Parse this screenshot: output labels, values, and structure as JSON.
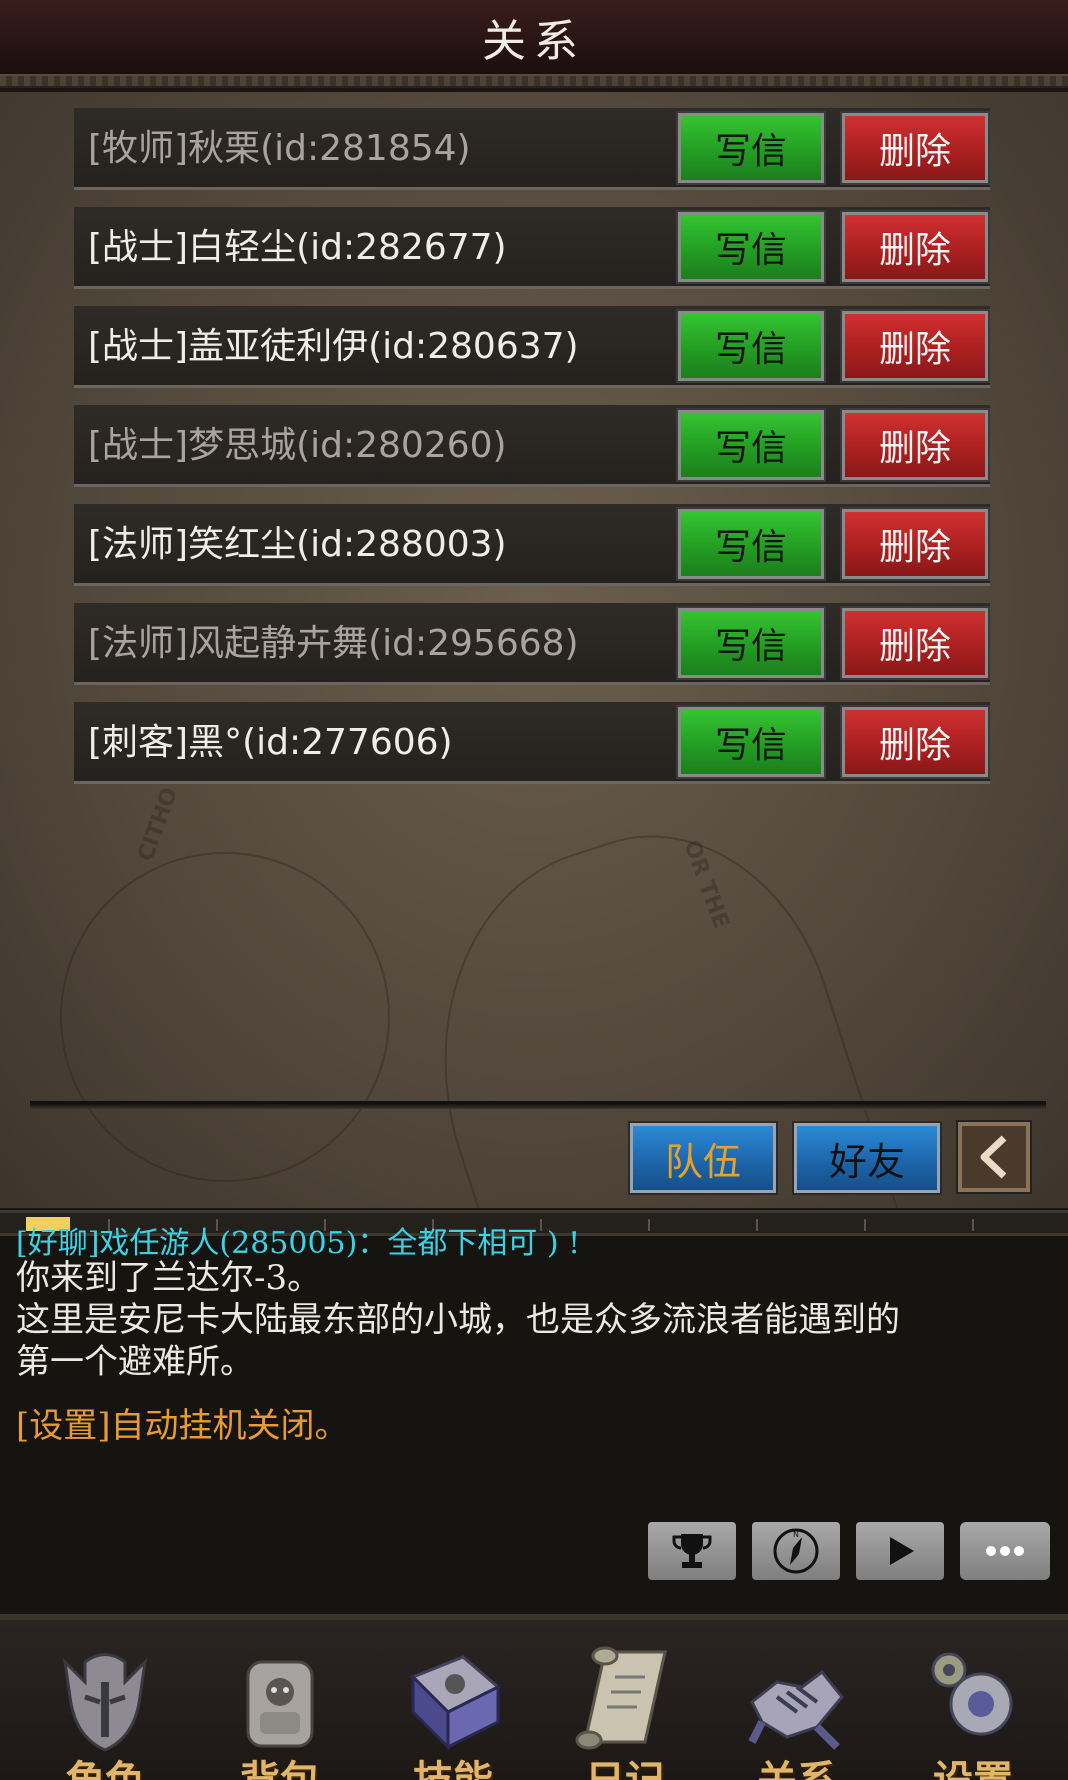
{
  "header": {
    "title": "关系"
  },
  "friends": [
    {
      "name": "[牧师]秋栗(id:281854)",
      "online": false
    },
    {
      "name": "[战士]白轻尘(id:282677)",
      "online": true
    },
    {
      "name": "[战士]盖亚徒利伊(id:280637)",
      "online": true
    },
    {
      "name": "[战士]梦思城(id:280260)",
      "online": false
    },
    {
      "name": "[法师]笑红尘(id:288003)",
      "online": true
    },
    {
      "name": "[法师]风起静卉舞(id:295668)",
      "online": false
    },
    {
      "name": "[刺客]黑°(id:277606)",
      "online": true
    }
  ],
  "buttons": {
    "write": "写信",
    "delete": "删除"
  },
  "tabs": {
    "team": "队伍",
    "friends": "好友"
  },
  "chat": {
    "cut_line": "[好聊]戏任游人(285005)：全都下相可 ) !",
    "lines": [
      "你来到了兰达尔-3。",
      "这里是安尼卡大陆最东部的小城，也是众多流浪者能遇到的",
      "第一个避难所。"
    ],
    "system": "[设置]自动挂机关闭。"
  },
  "nav": {
    "role": "角色",
    "bag": "背包",
    "skill": "技能",
    "diary": "日记",
    "relation": "关系",
    "settings": "设置"
  },
  "colors": {
    "write_button": "#229a22",
    "delete_button": "#a81f1f",
    "tab_button": "#1c63a8",
    "nav_label": "#e2b66a",
    "chat_system": "#e89a35",
    "chat_channel": "#3ad3e6"
  }
}
